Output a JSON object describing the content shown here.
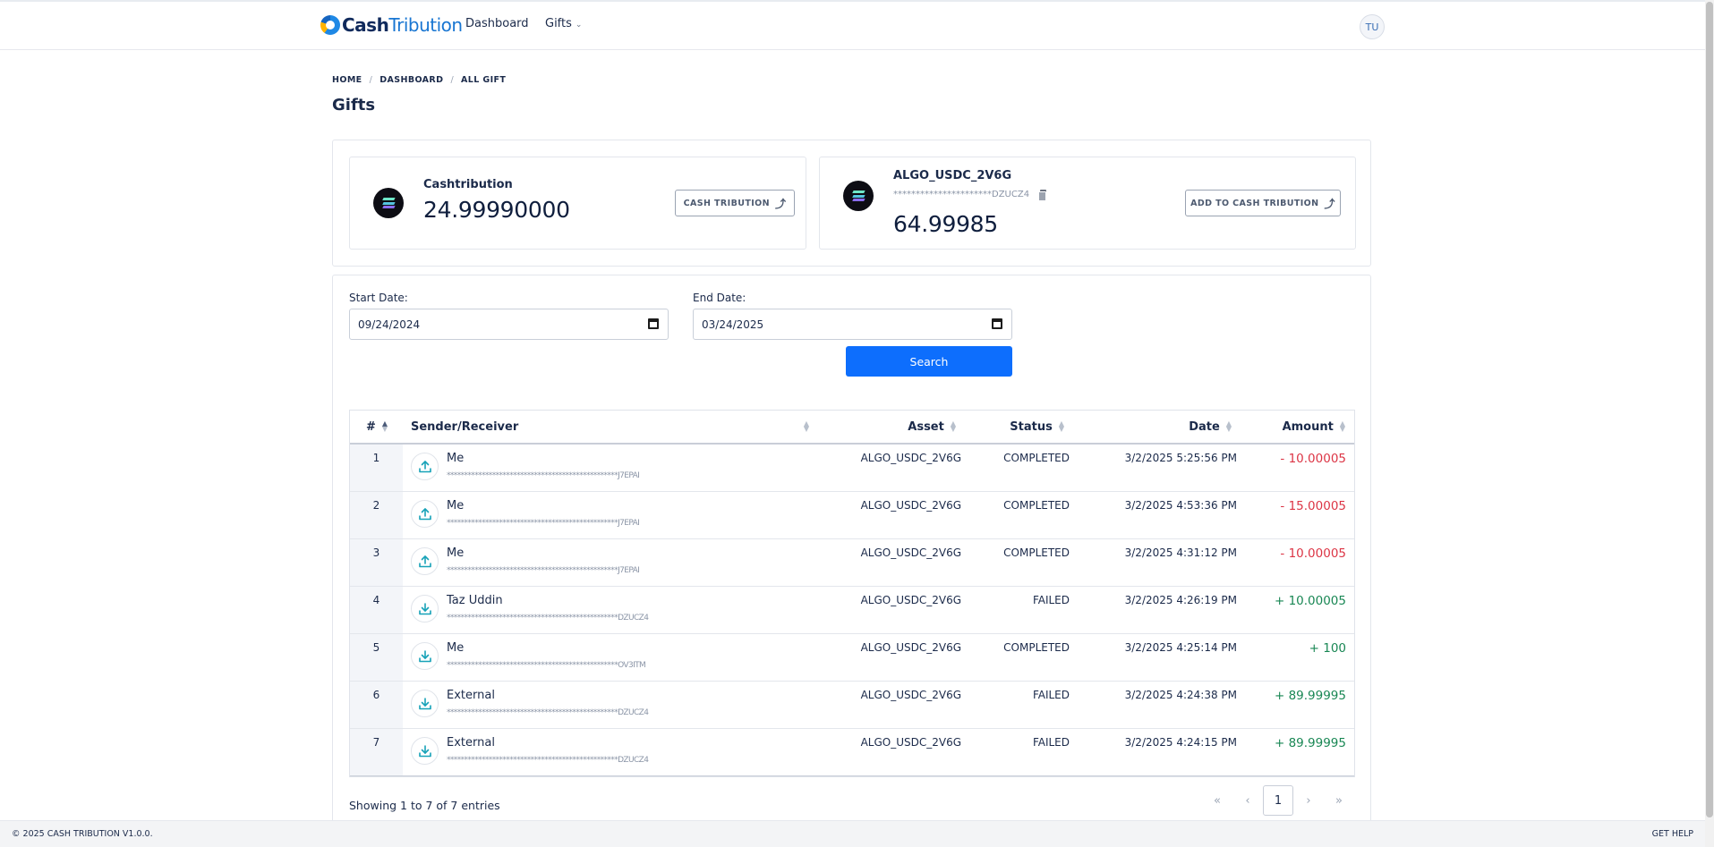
{
  "nav": {
    "logo_cash": "Cash",
    "logo_tribution": "Tribution",
    "dashboard": "Dashboard",
    "gifts": "Gifts",
    "avatar_initials": "TU"
  },
  "breadcrumb": [
    "HOME",
    "DASHBOARD",
    "ALL GIFT"
  ],
  "page_title": "Gifts",
  "wallets": [
    {
      "name": "Cashtribution",
      "balance": "24.99990000",
      "action": "CASH TRIBUTION",
      "icon": "solana-coin-icon"
    },
    {
      "name": "ALGO_USDC_2V6G",
      "address": "**********************DZUCZ4",
      "balance": "64.99985",
      "action": "ADD TO CASH TRIBUTION",
      "icon": "solana-coin-icon"
    }
  ],
  "filters": {
    "start_label": "Start Date:",
    "start_value": "09/24/2024",
    "end_label": "End Date:",
    "end_value": "03/24/2025",
    "search_label": "Search"
  },
  "table": {
    "columns": [
      "#",
      "Sender/Receiver",
      "Asset",
      "Status",
      "Date",
      "Amount"
    ],
    "rows": [
      {
        "num": "1",
        "name": "Me",
        "address": "*************************************************J7EPAI",
        "direction": "upload",
        "asset": "ALGO_USDC_2V6G",
        "status": "COMPLETED",
        "date": "3/2/2025 5:25:56 PM",
        "amount": "- 10.00005",
        "sign": "neg"
      },
      {
        "num": "2",
        "name": "Me",
        "address": "*************************************************J7EPAI",
        "direction": "upload",
        "asset": "ALGO_USDC_2V6G",
        "status": "COMPLETED",
        "date": "3/2/2025 4:53:36 PM",
        "amount": "- 15.00005",
        "sign": "neg"
      },
      {
        "num": "3",
        "name": "Me",
        "address": "*************************************************J7EPAI",
        "direction": "upload",
        "asset": "ALGO_USDC_2V6G",
        "status": "COMPLETED",
        "date": "3/2/2025 4:31:12 PM",
        "amount": "- 10.00005",
        "sign": "neg"
      },
      {
        "num": "4",
        "name": "Taz Uddin",
        "address": "*************************************************DZUCZ4",
        "direction": "download",
        "asset": "ALGO_USDC_2V6G",
        "status": "FAILED",
        "date": "3/2/2025 4:26:19 PM",
        "amount": "+ 10.00005",
        "sign": "pos"
      },
      {
        "num": "5",
        "name": "Me",
        "address": "*************************************************OV3ITM",
        "direction": "download",
        "asset": "ALGO_USDC_2V6G",
        "status": "COMPLETED",
        "date": "3/2/2025 4:25:14 PM",
        "amount": "+ 100",
        "sign": "pos"
      },
      {
        "num": "6",
        "name": "External",
        "address": "*************************************************DZUCZ4",
        "direction": "download",
        "asset": "ALGO_USDC_2V6G",
        "status": "FAILED",
        "date": "3/2/2025 4:24:38 PM",
        "amount": "+ 89.99995",
        "sign": "pos"
      },
      {
        "num": "7",
        "name": "External",
        "address": "*************************************************DZUCZ4",
        "direction": "download",
        "asset": "ALGO_USDC_2V6G",
        "status": "FAILED",
        "date": "3/2/2025 4:24:15 PM",
        "amount": "+ 89.99995",
        "sign": "pos"
      }
    ]
  },
  "entries_info": "Showing 1 to 7 of 7 entries",
  "pagination": {
    "first": "«",
    "prev": "‹",
    "current": "1",
    "next": "›",
    "last": "»"
  },
  "footer": {
    "copyright": "© 2025 CASH TRIBUTION V1.0.0.",
    "help": "GET HELP"
  },
  "colors": {
    "primary": "#0d6efd",
    "negative": "#dc3545",
    "positive": "#198754",
    "icon_accent": "#17a2b8"
  }
}
